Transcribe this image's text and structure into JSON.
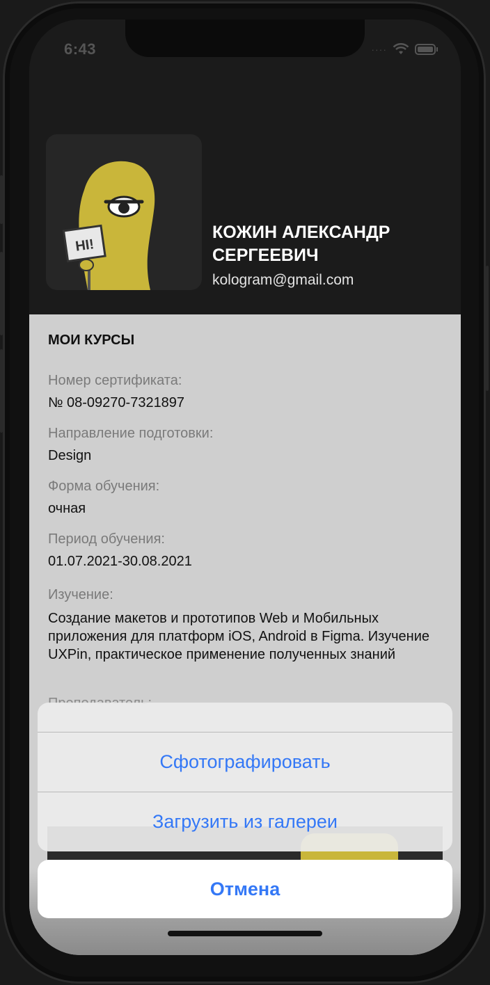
{
  "status_bar": {
    "time": "6:43"
  },
  "profile": {
    "name": "КОЖИН АЛЕКСАНДР СЕРГЕЕВИЧ",
    "email": "kologram@gmail.com",
    "avatar_sign": "HI!"
  },
  "courses": {
    "title": "МОИ КУРСЫ",
    "fields": [
      {
        "label": "Номер сертификата:",
        "value": "№ 08-09270-7321897"
      },
      {
        "label": "Направление подготовки:",
        "value": "Design"
      },
      {
        "label": "Форма обучения:",
        "value": "очная"
      },
      {
        "label": "Период обучения:",
        "value": "01.07.2021-30.08.2021"
      },
      {
        "label": "Изучение:",
        "value": "Создание макетов и прототипов Web и Мобильных приложения для платформ iOS, Android в Figma. Изучение UXPin, практическое применение полученных знаний"
      }
    ],
    "partial_label": "Преподаватель:"
  },
  "action_sheet": {
    "actions": [
      {
        "label": "Сфотографировать"
      },
      {
        "label": "Загрузить из галереи"
      }
    ],
    "cancel_label": "Отмена"
  },
  "colors": {
    "accent": "#3478f6",
    "header_bg": "#1b1b1b",
    "content_bg": "#cfcfcf",
    "avatar_yellow": "#c9b63a"
  }
}
